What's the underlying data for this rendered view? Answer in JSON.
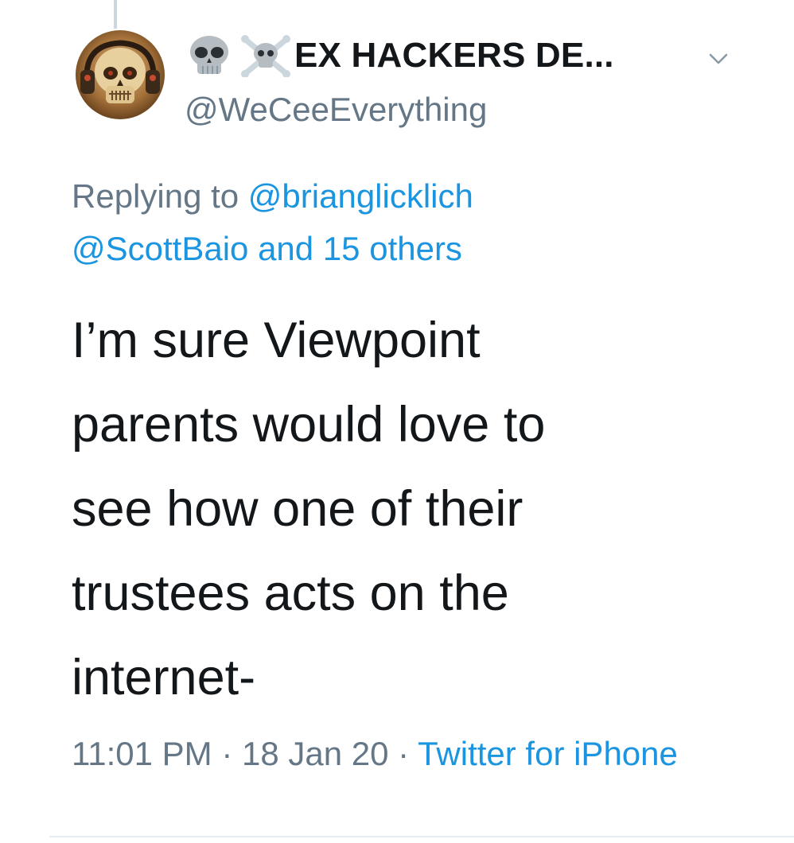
{
  "tweet": {
    "display_name": "EX HACKERS DE...",
    "handle": "@WeCeeEverything",
    "replying_prefix": "Replying to ",
    "replying_user": "@brianglicklich",
    "replying_others": "@ScottBaio and 15 others",
    "text": "I’m sure Viewpoint\nparents would love to\nsee how one of their\ntrustees acts on the\ninternet-",
    "time": "11:01 PM",
    "separator": " · ",
    "date": "18 Jan 20",
    "source": "Twitter for iPhone"
  },
  "icons": {
    "name_emoji_1": "skull-emoji-icon",
    "name_emoji_2": "skull-crossbones-emoji-icon",
    "menu": "chevron-down-icon"
  },
  "colors": {
    "link": "#1b95e0",
    "secondary_text": "#657786",
    "primary_text": "#14171a"
  }
}
